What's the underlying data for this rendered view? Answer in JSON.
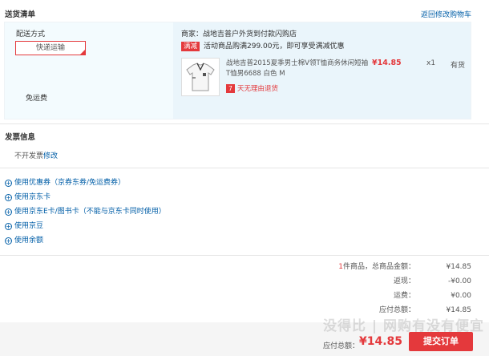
{
  "shipping": {
    "title": "送货清单",
    "back_to_cart": "返回修改购物车",
    "delivery_label": "配送方式",
    "delivery_method": "快递运输",
    "free_shipping": "免运费",
    "merchant": "商家：战地吉普户外货到付款闪购店",
    "promo_tag": "满减",
    "promo_text": "活动商品购满299.00元，即可享受满减优惠",
    "product": {
      "title": "战地吉普2015夏季男士棉V领T恤商务休闲短袖T恤男6688 白色 M",
      "price": "¥14.85",
      "qty": "x1",
      "stock": "有货",
      "return_badge": "7",
      "return_text": "7天无理由退货"
    }
  },
  "invoice": {
    "title": "发票信息",
    "value": "不开发票",
    "edit": "修改"
  },
  "options": [
    "使用优惠券（京券东券/免运费券）",
    "使用京东卡",
    "使用京东E卡/图书卡（不能与京东卡同时使用）",
    "使用京豆",
    "使用余额"
  ],
  "summary": {
    "count": "1",
    "count_suffix": "件商品，总商品金额：",
    "goods_total": "¥14.85",
    "rebate_label": "返现：",
    "rebate": "-¥0.00",
    "freight_label": "运费：",
    "freight": "¥0.00",
    "payable_label": "应付总额：",
    "payable": "¥14.85"
  },
  "footer": {
    "total_label": "应付总额：",
    "total_value": "¥14.85",
    "submit": "提交订单",
    "watermark": "没得比 | 网购有没有便宜"
  }
}
